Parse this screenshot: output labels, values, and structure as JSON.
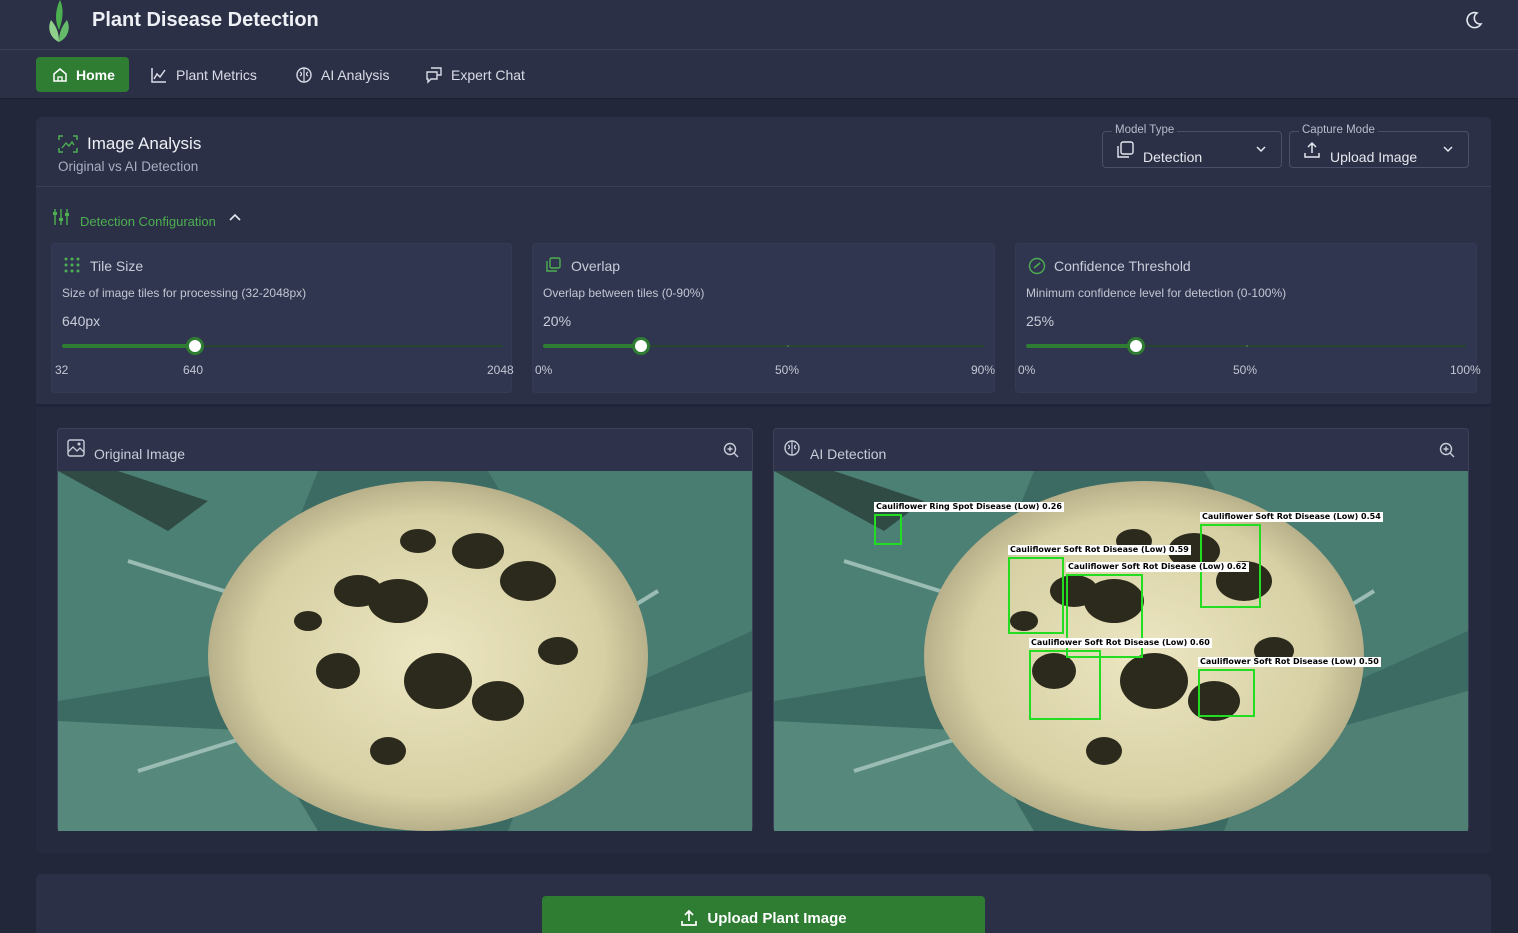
{
  "header": {
    "title": "Plant Disease Detection",
    "theme_icon": "moon-icon"
  },
  "nav": [
    {
      "label": "Home",
      "icon": "home-icon",
      "active": true
    },
    {
      "label": "Plant Metrics",
      "icon": "chart-icon"
    },
    {
      "label": "AI Analysis",
      "icon": "brain-icon"
    },
    {
      "label": "Expert Chat",
      "icon": "chat-icon"
    }
  ],
  "analysis": {
    "title": "Image Analysis",
    "subtitle": "Original vs AI Detection",
    "model_type": {
      "label": "Model Type",
      "value": "Detection"
    },
    "capture_mode": {
      "label": "Capture Mode",
      "value": "Upload Image"
    }
  },
  "config": {
    "label": "Detection Configuration",
    "tile": {
      "title": "Tile Size",
      "description": "Size of image tiles for processing (32-2048px)",
      "value_text": "640px",
      "value": 640,
      "min": 32,
      "max": 2048,
      "ticks": [
        "32",
        "640",
        "2048"
      ]
    },
    "overlap": {
      "title": "Overlap",
      "description": "Overlap between tiles (0-90%)",
      "value_text": "20%",
      "value": 20,
      "min": 0,
      "max": 90,
      "ticks": [
        "0%",
        "50%",
        "90%"
      ]
    },
    "confidence": {
      "title": "Confidence Threshold",
      "description": "Minimum confidence level for detection (0-100%)",
      "value_text": "25%",
      "value": 25,
      "min": 0,
      "max": 100,
      "ticks": [
        "0%",
        "50%",
        "100%"
      ]
    }
  },
  "images": {
    "original_title": "Original Image",
    "detection_title": "AI Detection",
    "detections": [
      {
        "label": "Cauliflower Ring Spot Disease (Low) 0.26"
      },
      {
        "label": "Cauliflower Soft Rot Disease (Low) 0.54"
      },
      {
        "label": "Cauliflower Soft Rot Disease (Low) 0.59"
      },
      {
        "label": "Cauliflower Soft Rot Disease (Low) 0.62"
      },
      {
        "label": "Cauliflower Soft Rot Disease (Low) 0.60"
      },
      {
        "label": "Cauliflower Soft Rot Disease (Low) 0.50"
      }
    ]
  },
  "upload": {
    "label": "Upload Plant Image"
  },
  "colors": {
    "accent": "#2e7d32",
    "accent_text": "#4caf50",
    "background": "#23273a",
    "surface": "#2b3046",
    "box": "#22dd22"
  }
}
